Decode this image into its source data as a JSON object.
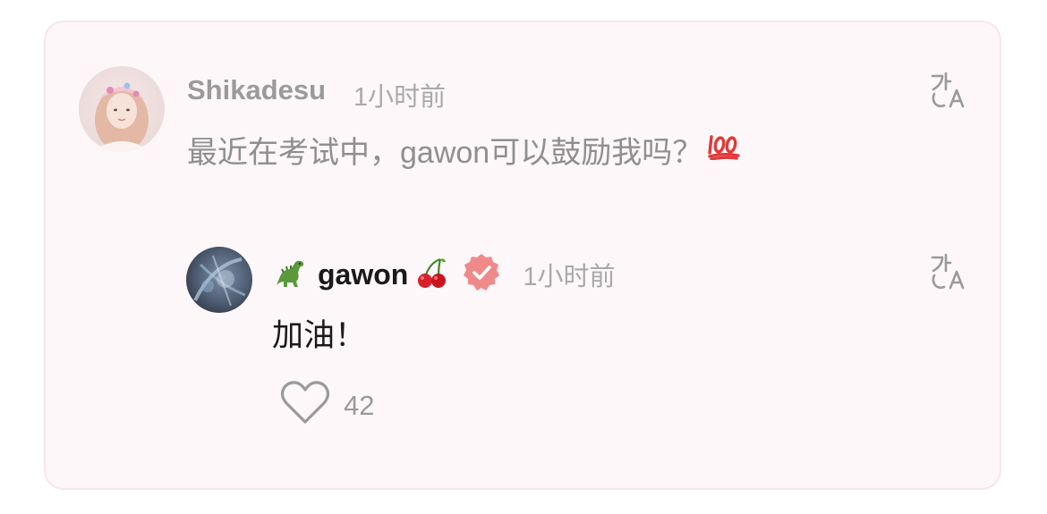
{
  "top_comment": {
    "username": "Shikadesu",
    "time": "1小时前",
    "text": "最近在考试中，gawon可以鼓励我吗？",
    "emoji": "100-emoji",
    "translate_icon": "translate-icon"
  },
  "reply": {
    "prefix_emoji": "dinosaur-emoji",
    "username": "gawon",
    "suffix_emoji": "cherries-emoji",
    "badge": "verified-badge",
    "badge_color": "#f08a8a",
    "time": "1小时前",
    "text": "加油！",
    "likes": "42",
    "translate_icon": "translate-icon"
  },
  "colors": {
    "card_bg": "#fdf7f9",
    "card_border": "#f6e6ec",
    "muted_text": "#9b9b9b",
    "primary_text": "#1a1a1a"
  }
}
